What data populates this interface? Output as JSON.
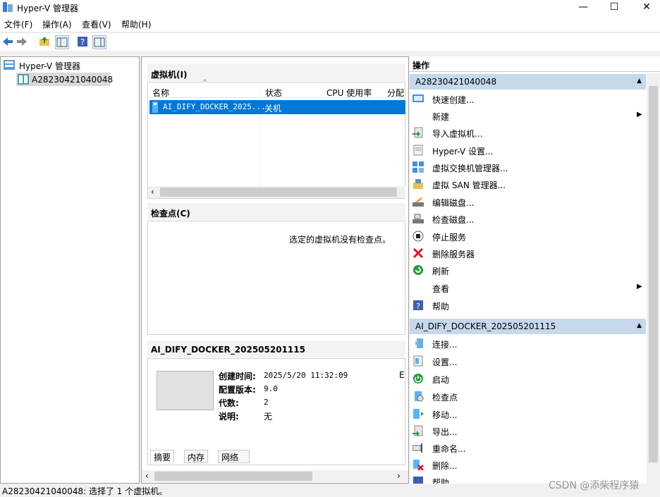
{
  "window": {
    "title": "Hyper-V 管理器"
  },
  "menu": [
    "文件(F)",
    "操作(A)",
    "查看(V)",
    "帮助(H)"
  ],
  "tree": {
    "root": "Hyper-V 管理器",
    "host": "A28230421040048"
  },
  "vm_section": {
    "title": "虚拟机(I)",
    "columns": [
      "名称",
      "状态",
      "CPU 使用率",
      "分配"
    ],
    "rows": [
      {
        "name": "AI_DIFY_DOCKER_2025...",
        "state": "关机"
      }
    ]
  },
  "checkpoint_section": {
    "title": "检查点(C)",
    "empty_text": "选定的虚拟机没有检查点。"
  },
  "details": {
    "title": "AI_DIFY_DOCKER_202505201115",
    "fields": [
      {
        "label": "创建时间:",
        "value": "2025/5/20 11:32:09"
      },
      {
        "label": "配置版本:",
        "value": "9.0"
      },
      {
        "label": "代数:",
        "value": "2"
      },
      {
        "label": "说明:",
        "value": "无"
      }
    ],
    "truncated_char": "E",
    "tabs": [
      "摘要",
      "内存",
      "网络"
    ]
  },
  "actions": {
    "title": "操作",
    "host_group": "A28230421040048",
    "host_items": [
      "快速创建...",
      "新建",
      "导入虚拟机...",
      "Hyper-V 设置...",
      "虚拟交换机管理器...",
      "虚拟 SAN 管理器...",
      "编辑磁盘...",
      "检查磁盘...",
      "停止服务",
      "删除服务器",
      "刷新",
      "查看",
      "帮助"
    ],
    "vm_group": "AI_DIFY_DOCKER_202505201115",
    "vm_items": [
      "连接...",
      "设置...",
      "启动",
      "检查点",
      "移动...",
      "导出...",
      "重命名...",
      "删除...",
      "帮助"
    ]
  },
  "status": "A28230421040048: 选择了 1 个虚拟机。",
  "watermark": "CSDN @添柴程序猿",
  "colors": {
    "selection": "#0078d7",
    "action_header": "#c5d8ec",
    "delete_red": "#e81123",
    "green": "#1f9e3a"
  }
}
